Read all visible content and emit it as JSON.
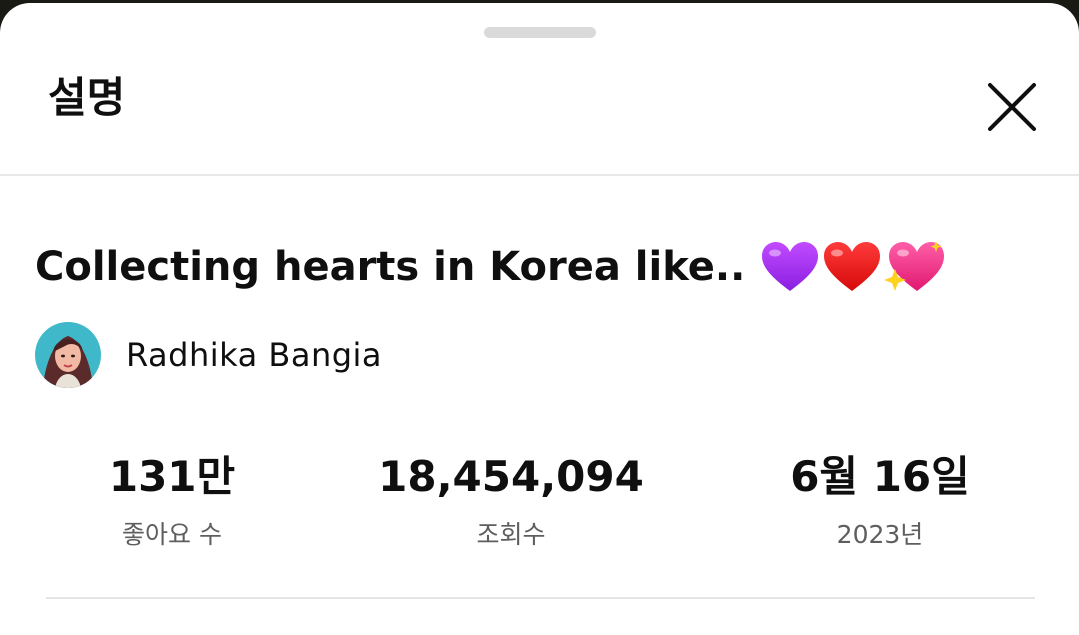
{
  "sheet": {
    "title": "설명",
    "close_icon": "close-icon"
  },
  "video": {
    "title": "Collecting hearts in Korea like..",
    "title_emojis": [
      "purple-heart-icon",
      "red-heart-icon",
      "sparkling-heart-icon"
    ]
  },
  "channel": {
    "name": "Radhika Bangia",
    "avatar_icon": "avatar"
  },
  "stats": {
    "likes": {
      "value": "131만",
      "label": "좋아요 수"
    },
    "views": {
      "value": "18,454,094",
      "label": "조회수"
    },
    "date": {
      "value": "6월 16일",
      "label": "2023년"
    }
  },
  "colors": {
    "background": "#ffffff",
    "text": "#0f0f0f",
    "secondary_text": "#5e5e5e",
    "divider": "#e5e5e5"
  }
}
